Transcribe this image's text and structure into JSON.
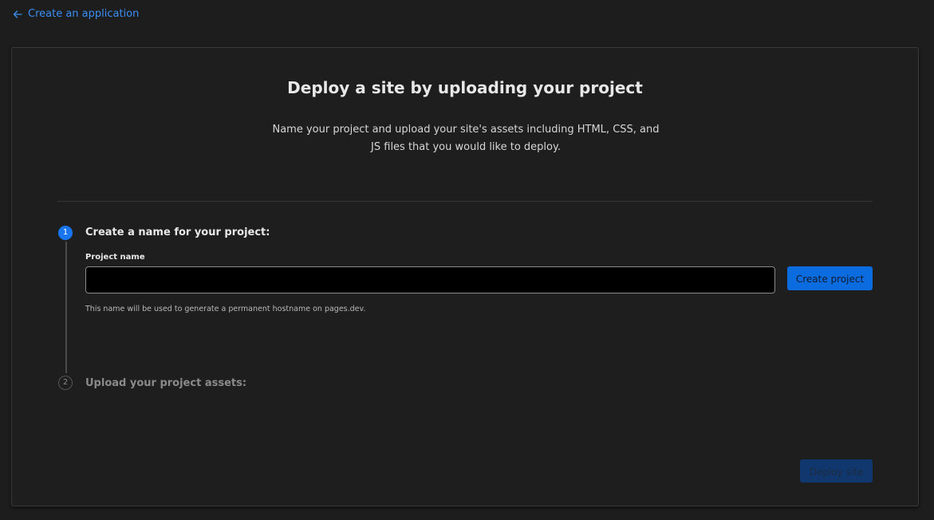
{
  "nav": {
    "back_label": "Create an application",
    "back_icon": "arrow-left-icon"
  },
  "header": {
    "title": "Deploy a site by uploading your project",
    "description": "Name your project and upload your site's assets including HTML, CSS, and JS files that you would like to deploy."
  },
  "steps": [
    {
      "number": "1",
      "title": "Create a name for your project:",
      "state": "active"
    },
    {
      "number": "2",
      "title": "Upload your project assets:",
      "state": "inactive"
    }
  ],
  "form": {
    "field_label": "Project name",
    "input_value": "",
    "input_placeholder": "",
    "help_text": "This name will be used to generate a permanent hostname on pages.dev.",
    "create_button": "Create project"
  },
  "footer": {
    "deploy_button": "Deploy site"
  },
  "colors": {
    "accent": "#0b6ce0",
    "link": "#3b8ff3",
    "background": "#1d1d1d",
    "disabled_button": "#11386e"
  }
}
